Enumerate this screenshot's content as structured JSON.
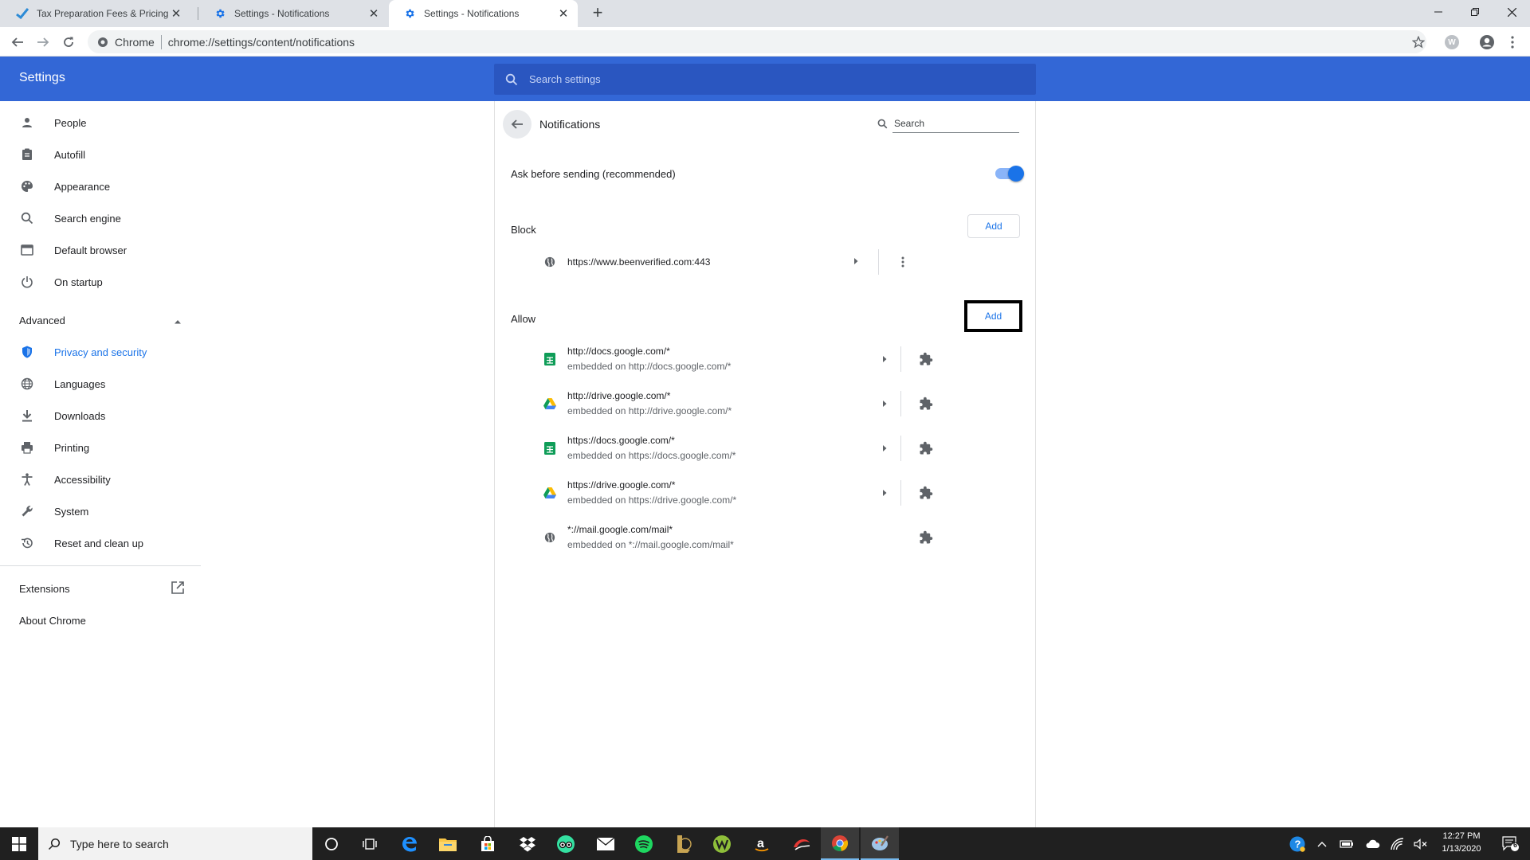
{
  "browser": {
    "tabs": [
      {
        "title": "Tax Preparation Fees & Pricing O",
        "icon": "turbotax-check-icon"
      },
      {
        "title": "Settings - Notifications",
        "icon": "settings-gear-icon"
      },
      {
        "title": "Settings - Notifications",
        "icon": "settings-gear-icon"
      }
    ],
    "omnibox": {
      "chip": "Chrome",
      "url": "chrome://settings/content/notifications"
    },
    "profile_initial": "W"
  },
  "header": {
    "title": "Settings",
    "search_placeholder": "Search settings"
  },
  "sidebar": {
    "items": [
      {
        "label": "People",
        "icon": "person-icon"
      },
      {
        "label": "Autofill",
        "icon": "clipboard-icon"
      },
      {
        "label": "Appearance",
        "icon": "palette-icon"
      },
      {
        "label": "Search engine",
        "icon": "search-icon"
      },
      {
        "label": "Default browser",
        "icon": "browser-window-icon"
      },
      {
        "label": "On startup",
        "icon": "power-icon"
      }
    ],
    "advanced_label": "Advanced",
    "advanced_items": [
      {
        "label": "Privacy and security",
        "icon": "shield-icon",
        "selected": true
      },
      {
        "label": "Languages",
        "icon": "globe-icon"
      },
      {
        "label": "Downloads",
        "icon": "download-icon"
      },
      {
        "label": "Printing",
        "icon": "printer-icon"
      },
      {
        "label": "Accessibility",
        "icon": "accessibility-icon"
      },
      {
        "label": "System",
        "icon": "wrench-icon"
      },
      {
        "label": "Reset and clean up",
        "icon": "history-icon"
      }
    ],
    "extensions_label": "Extensions",
    "about_label": "About Chrome"
  },
  "main": {
    "title": "Notifications",
    "search_placeholder": "Search",
    "ask_label": "Ask before sending (recommended)",
    "ask_enabled": true,
    "block_label": "Block",
    "allow_label": "Allow",
    "add_label": "Add",
    "blocked_sites": [
      {
        "name": "https://www.beenverified.com:443",
        "icon": "globe-icon"
      }
    ],
    "allowed_sites": [
      {
        "name": "http://docs.google.com/*",
        "sub": "embedded on http://docs.google.com/*",
        "icon": "sheets-icon",
        "arrow": true
      },
      {
        "name": "http://drive.google.com/*",
        "sub": "embedded on http://drive.google.com/*",
        "icon": "drive-icon",
        "arrow": true
      },
      {
        "name": "https://docs.google.com/*",
        "sub": "embedded on https://docs.google.com/*",
        "icon": "sheets-icon",
        "arrow": true
      },
      {
        "name": "https://drive.google.com/*",
        "sub": "embedded on https://drive.google.com/*",
        "icon": "drive-icon",
        "arrow": true
      },
      {
        "name": "*://mail.google.com/mail*",
        "sub": "embedded on *://mail.google.com/mail*",
        "icon": "globe-icon",
        "arrow": false
      }
    ]
  },
  "taskbar": {
    "search_placeholder": "Type here to search",
    "time": "12:27 PM",
    "date": "1/13/2020",
    "notification_count": "6"
  },
  "colors": {
    "accent": "#1a73e8",
    "header": "#3367d6",
    "taskbar": "#202020"
  }
}
